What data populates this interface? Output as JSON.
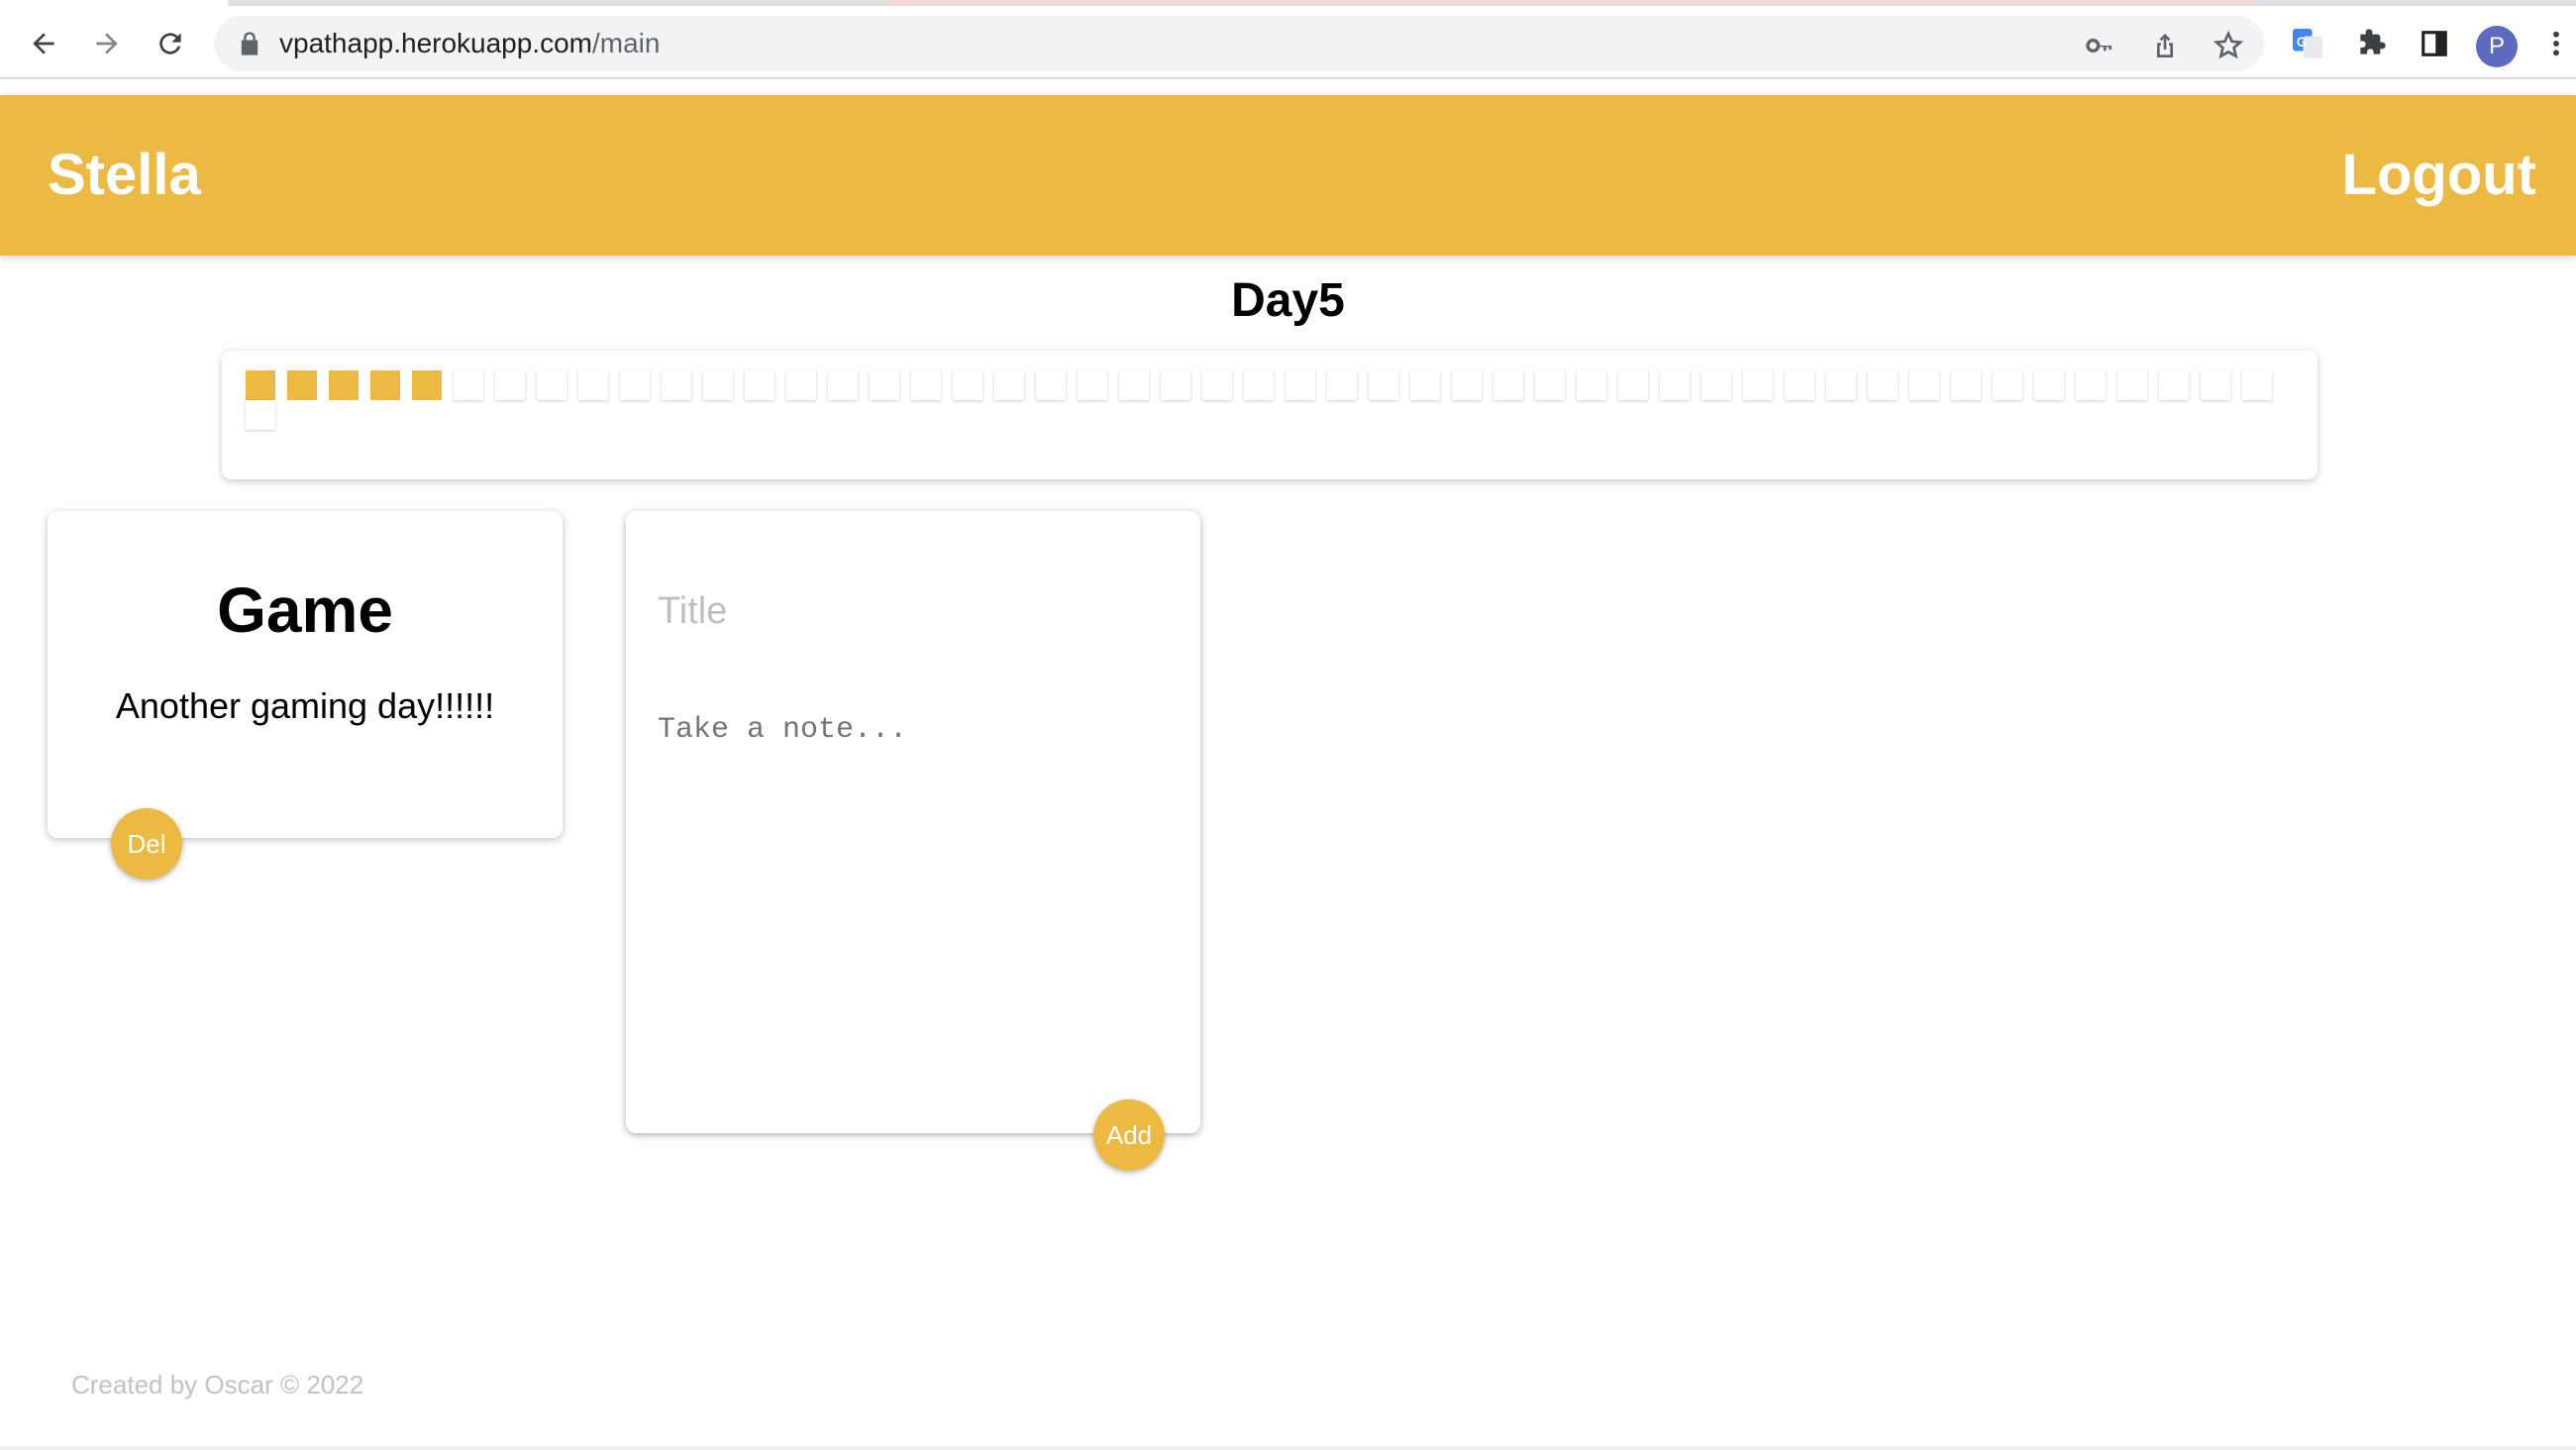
{
  "browser": {
    "url_host": "vpathapp.herokuapp.com",
    "url_path": "/main",
    "profile_initial": "P",
    "icons": {
      "back": "arrow-left-icon",
      "forward": "arrow-right-icon",
      "reload": "reload-icon",
      "lock": "lock-icon",
      "key": "key-icon",
      "share": "share-icon",
      "bookmark": "star-icon",
      "translate": "translate-icon",
      "extensions": "puzzle-icon",
      "sidepanel": "side-panel-icon",
      "menu": "kebab-menu-icon"
    }
  },
  "header": {
    "brand": "Stella",
    "logout_label": "Logout",
    "color": "#ecb942"
  },
  "day": {
    "title": "Day5",
    "completed_days": 5,
    "total_days": 50
  },
  "notes": [
    {
      "title": "Game",
      "content": "Another gaming day!!!!!!",
      "delete_label": "Del"
    }
  ],
  "create_form": {
    "title_placeholder": "Title",
    "content_placeholder": "Take a note...",
    "add_label": "Add"
  },
  "footer": {
    "text": "Created by Oscar © 2022"
  }
}
